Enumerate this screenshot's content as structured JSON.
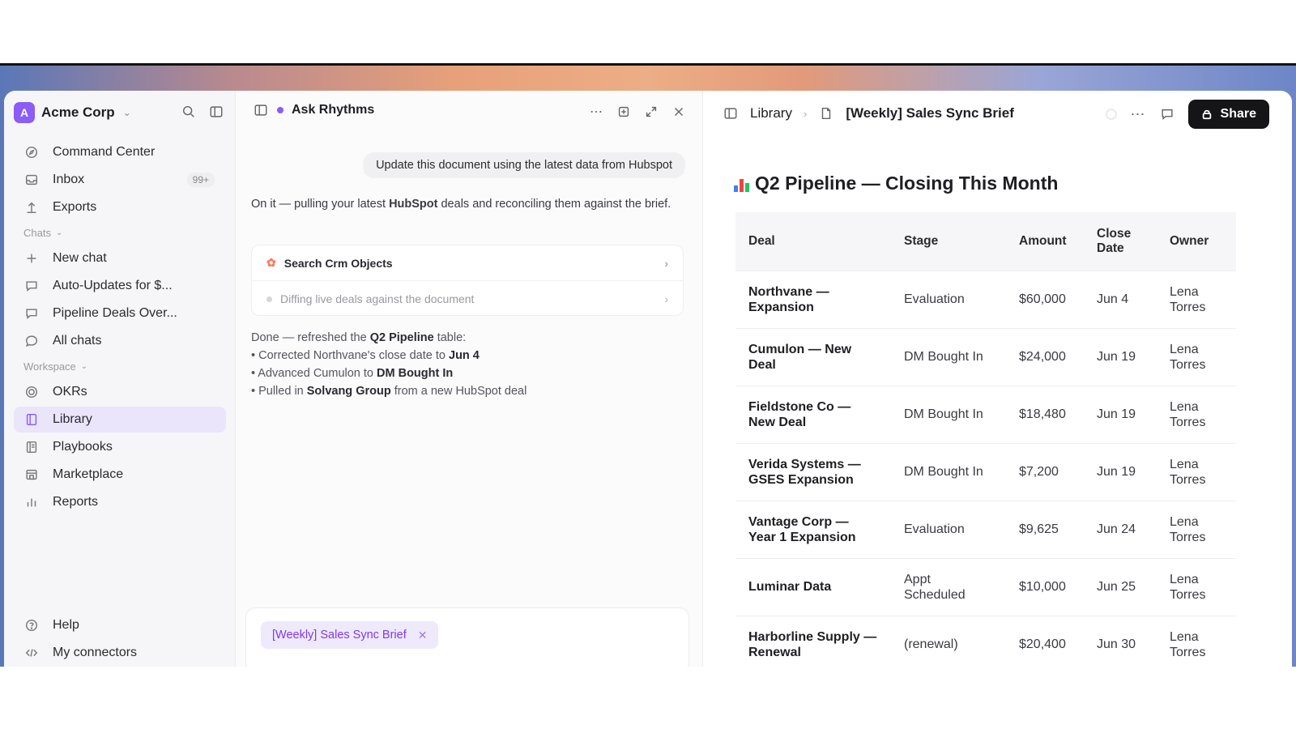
{
  "workspace": {
    "initial": "A",
    "name": "Acme Corp"
  },
  "sidebar": {
    "top_items": [
      {
        "label": "Command Center",
        "icon": "compass-icon"
      },
      {
        "label": "Inbox",
        "icon": "inbox-icon",
        "badge": "99+"
      },
      {
        "label": "Exports",
        "icon": "upload-icon"
      }
    ],
    "chats_label": "Chats",
    "chat_items": [
      {
        "label": "New chat",
        "icon": "plus-icon"
      },
      {
        "label": "Auto-Updates for $...",
        "icon": "chat-bubble-icon"
      },
      {
        "label": "Pipeline Deals Over...",
        "icon": "chat-bubble-icon"
      },
      {
        "label": "All chats",
        "icon": "chats-icon"
      }
    ],
    "workspace_label": "Workspace",
    "workspace_items": [
      {
        "label": "OKRs",
        "icon": "target-icon"
      },
      {
        "label": "Library",
        "icon": "book-icon",
        "active": true
      },
      {
        "label": "Playbooks",
        "icon": "playbook-icon"
      },
      {
        "label": "Marketplace",
        "icon": "store-icon"
      },
      {
        "label": "Reports",
        "icon": "bar-chart-icon"
      }
    ],
    "bottom_items": [
      {
        "label": "Help",
        "icon": "help-icon"
      },
      {
        "label": "My connectors",
        "icon": "code-icon"
      }
    ]
  },
  "chat": {
    "title": "Ask Rhythms",
    "user_message": "Update this document using the latest data from Hubspot",
    "ai_intro_pre": "On it — pulling your latest ",
    "ai_intro_bold": "HubSpot",
    "ai_intro_post": " deals and reconciling them against the brief.",
    "tool_steps": [
      {
        "label": "Search Crm Objects"
      },
      {
        "label": "Diffing live deals against the document"
      }
    ],
    "done": {
      "line1_pre": "Done — refreshed the ",
      "line1_bold": "Q2 Pipeline",
      "line1_post": " table:",
      "b1_pre": "• Corrected Northvane's close date to ",
      "b1_bold": "Jun 4",
      "b2_pre": "• Advanced Cumulon to ",
      "b2_bold": "DM Bought In",
      "b3_pre": "• Pulled in ",
      "b3_bold": "Solvang Group",
      "b3_post": " from a new HubSpot deal"
    },
    "context_chip": "[Weekly] Sales Sync Brief"
  },
  "doc": {
    "breadcrumb_root": "Library",
    "breadcrumb_doc": "[Weekly] Sales Sync Brief",
    "share_label": "Share",
    "heading": "Q2 Pipeline — Closing This Month",
    "columns": [
      "Deal",
      "Stage",
      "Amount",
      "Close Date",
      "Owner"
    ],
    "rows": [
      [
        "Northvane — Expansion",
        "Evaluation",
        "$60,000",
        "Jun 4",
        "Lena Torres"
      ],
      [
        "Cumulon — New Deal",
        "DM Bought In",
        "$24,000",
        "Jun 19",
        "Lena Torres"
      ],
      [
        "Fieldstone Co — New Deal",
        "DM Bought In",
        "$18,480",
        "Jun 19",
        "Lena Torres"
      ],
      [
        "Verida Systems — GSES Expansion",
        "DM Bought In",
        "$7,200",
        "Jun 19",
        "Lena Torres"
      ],
      [
        "Vantage Corp — Year 1 Expansion",
        "Evaluation",
        "$9,625",
        "Jun 24",
        "Lena Torres"
      ],
      [
        "Luminar Data",
        "Appt Scheduled",
        "$10,000",
        "Jun 25",
        "Lena Torres"
      ],
      [
        "Harborline Supply — Renewal",
        "(renewal)",
        "$20,400",
        "Jun 30",
        "Lena Torres"
      ]
    ]
  },
  "colors": {
    "accent": "#8b5cf6",
    "active_bg": "#ebe5fb",
    "hubspot": "#ff7a59"
  }
}
